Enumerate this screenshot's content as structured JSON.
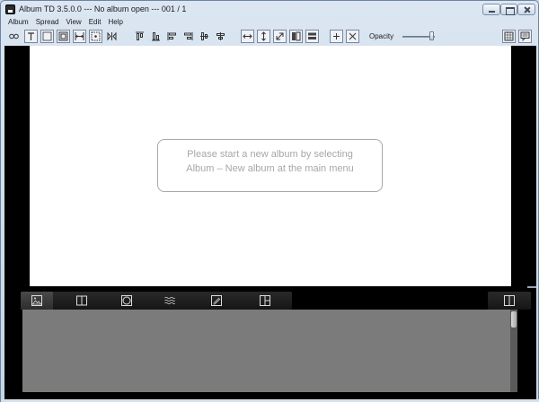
{
  "window": {
    "title": "Album TD 3.5.0.0 --- No album open --- 001 / 1"
  },
  "menu": {
    "items": [
      "Album",
      "Spread",
      "View",
      "Edit",
      "Help"
    ]
  },
  "toolbar": {
    "opacity_label": "Opacity",
    "opacity_value": 0.9,
    "icons": [
      "link-icon",
      "text-frame-icon",
      "image-frame-icon",
      "frame-icon",
      "width-spread-icon",
      "distribute-icon",
      "flip-icon",
      "align-top-icon",
      "align-bottom-icon",
      "align-left-icon",
      "align-right-icon",
      "align-center-v-icon",
      "align-center-h-icon",
      "stretch-width-icon",
      "stretch-height-icon",
      "fit-diagonal-icon",
      "column-icon",
      "row-icon",
      "add-icon",
      "delete-icon",
      "grid-icon",
      "comment-icon"
    ]
  },
  "canvas": {
    "message_line1": "Please start a new album by selecting",
    "message_line2": "Album – New album at the main menu"
  },
  "bottom_panel": {
    "tabs": [
      "photos-tab",
      "layouts-tab",
      "frames-tab",
      "backgrounds-tab",
      "cliparts-tab",
      "templates-tab"
    ],
    "active_tab": 0
  }
}
